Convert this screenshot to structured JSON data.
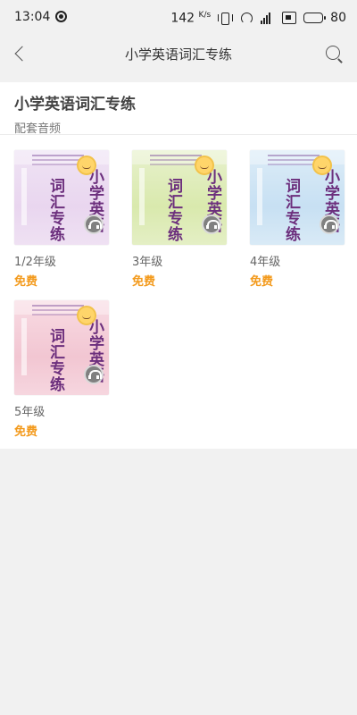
{
  "status_bar": {
    "time": "13:04",
    "net_speed": "142",
    "net_unit": "K/s",
    "battery": "80",
    "battery_level": 0.8
  },
  "nav": {
    "title": "小学英语词汇专练",
    "back_icon": "chevron-left-icon",
    "search_icon": "search-icon"
  },
  "header": {
    "title": "小学英语词汇专练",
    "subtitle": "配套音频"
  },
  "books": [
    {
      "label": "1/2年级",
      "price": "免费",
      "cover_color": "#ead8f0"
    },
    {
      "label": "3年级",
      "price": "免费",
      "cover_color": "#dbeab1"
    },
    {
      "label": "4年级",
      "price": "免费",
      "cover_color": "#c9e1f3"
    },
    {
      "label": "5年级",
      "price": "免费",
      "cover_color": "#f3c9d4"
    }
  ],
  "price_color": "#f39a1c"
}
